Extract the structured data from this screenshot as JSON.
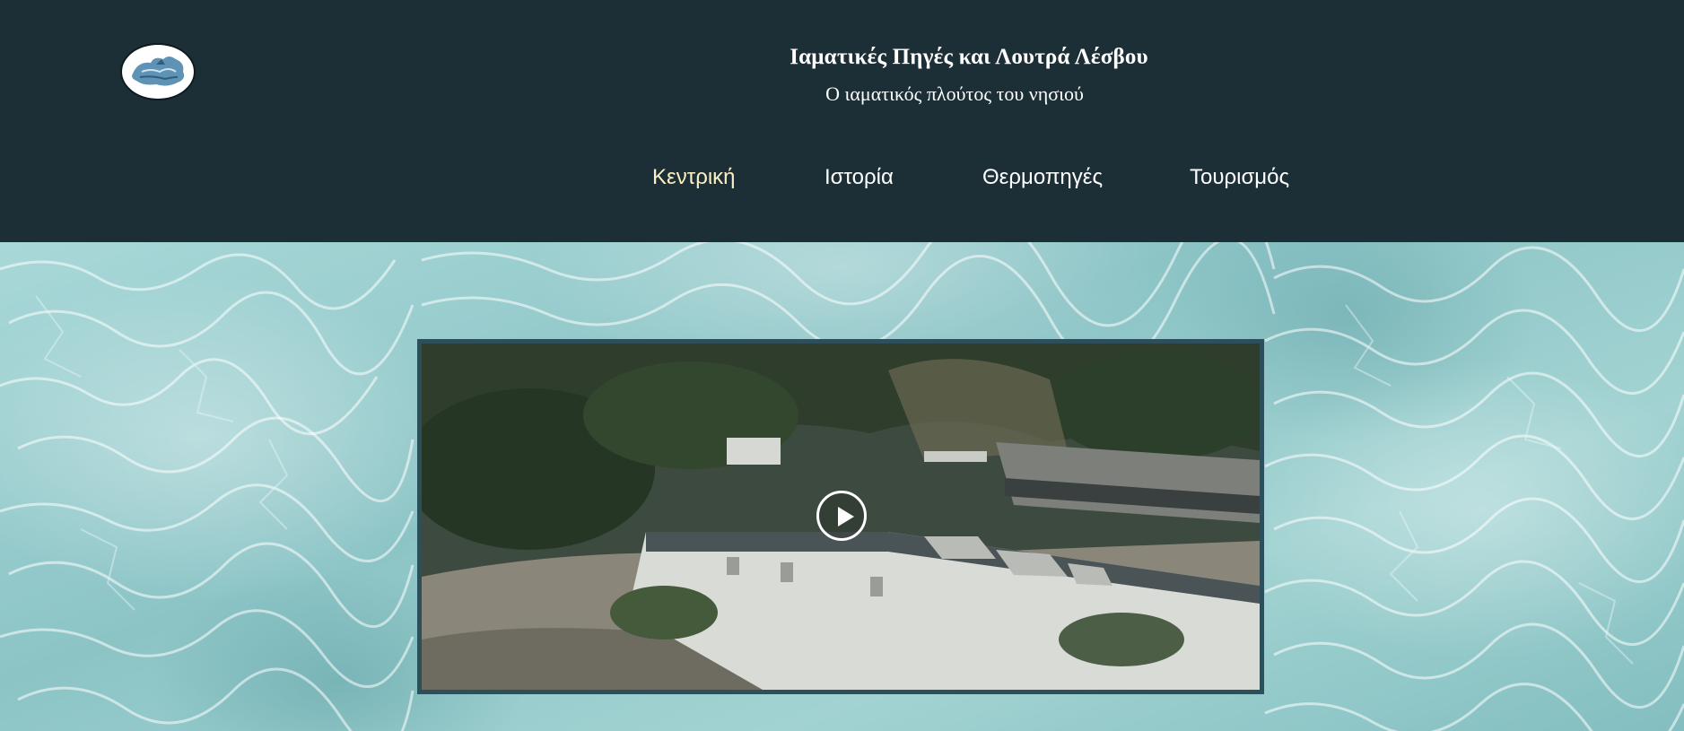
{
  "header": {
    "title": "Ιαματικές Πηγές και Λουτρά Λέσβου",
    "subtitle": "Ο ιαματικός πλούτος του νησιού",
    "logo_icon": "lesvos-island-logo-icon",
    "background_color": "#1c2f36"
  },
  "nav": {
    "items": [
      {
        "label": "Κεντρική",
        "active": true
      },
      {
        "label": "Ιστορία",
        "active": false
      },
      {
        "label": "Θερμοπηγές",
        "active": false
      },
      {
        "label": "Τουρισμός",
        "active": false
      }
    ],
    "active_color": "#fbefc4",
    "color": "#ffffff"
  },
  "main": {
    "background": "pool-water-texture",
    "video": {
      "play_icon": "play-icon",
      "frame_color": "#2d4f5c"
    }
  }
}
